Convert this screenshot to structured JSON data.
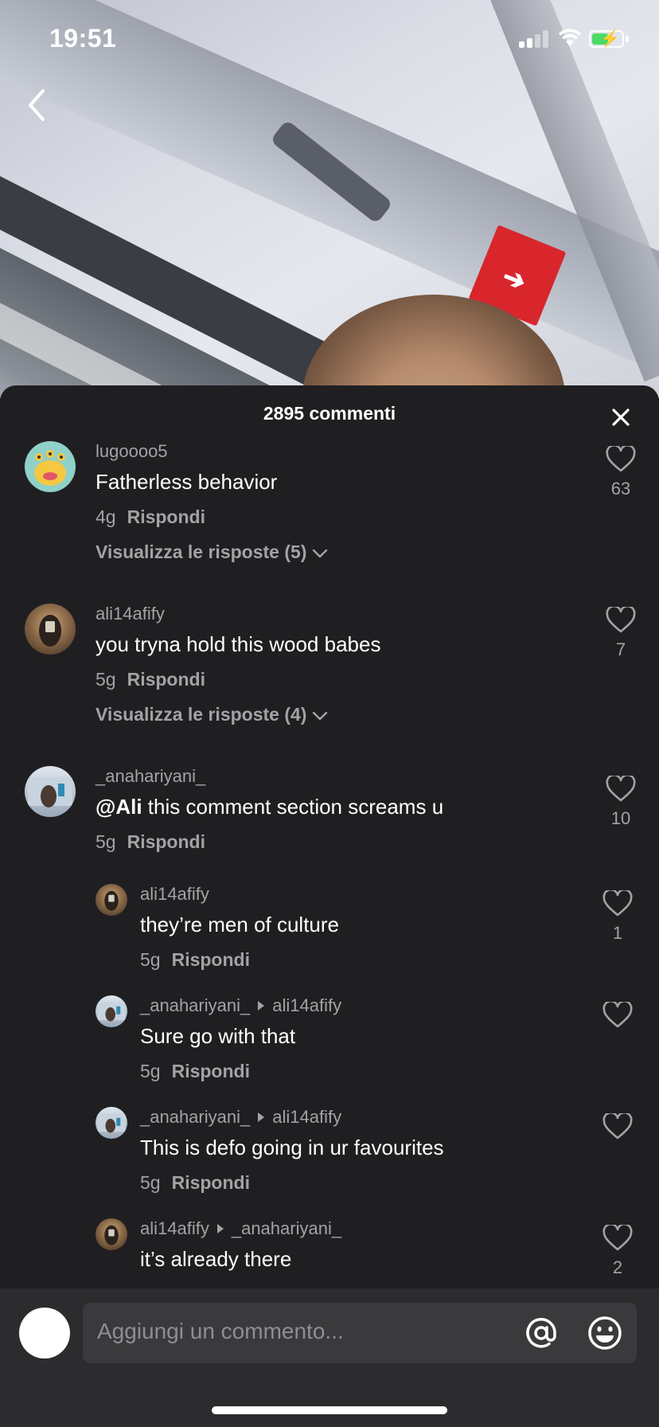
{
  "status_bar": {
    "time": "19:51",
    "battery_level": 0.55,
    "battery_color": "#4cd964",
    "signal_icon": "cellular-signal-icon",
    "wifi_icon": "wifi-icon",
    "battery_icon": "battery-charging-icon"
  },
  "nav": {
    "back_icon": "chevron-left-icon"
  },
  "sheet": {
    "title": "2895 commenti",
    "close_icon": "close-icon"
  },
  "comments": [
    {
      "user": "lugoooo5",
      "text": "Fatherless behavior",
      "age": "4g",
      "reply_label": "Rispondi",
      "likes": "63",
      "view_replies": "Visualizza le risposte (5)"
    },
    {
      "user": "ali14afify",
      "text": "you tryna hold this wood babes",
      "age": "5g",
      "reply_label": "Rispondi",
      "likes": "7",
      "view_replies": "Visualizza le risposte (4)"
    },
    {
      "user": "_anahariyani_",
      "mention": "@Ali",
      "text": " this comment section screams u",
      "age": "5g",
      "reply_label": "Rispondi",
      "likes": "10"
    }
  ],
  "replies": [
    {
      "user": "ali14afify",
      "reply_to": "",
      "text": "they’re men of culture",
      "age": "5g",
      "reply_label": "Rispondi",
      "likes": "1"
    },
    {
      "user": "_anahariyani_",
      "reply_to": "ali14afify",
      "text": "Sure go with that",
      "age": "5g",
      "reply_label": "Rispondi",
      "likes": ""
    },
    {
      "user": "_anahariyani_",
      "reply_to": "ali14afify",
      "text": "This is defo going in ur favourites",
      "age": "5g",
      "reply_label": "Rispondi",
      "likes": ""
    },
    {
      "user": "ali14afify",
      "reply_to": "_anahariyani_",
      "text": "it’s already there",
      "age": "",
      "reply_label": "",
      "likes": "2"
    }
  ],
  "input": {
    "placeholder": "Aggiungi un commento...",
    "mention_icon": "at-sign-icon",
    "emoji_icon": "emoji-icon"
  },
  "colors": {
    "sheet_bg": "#1f1f21",
    "secondary_text": "#a3a3a6",
    "input_bar_bg": "#2c2c2e"
  }
}
